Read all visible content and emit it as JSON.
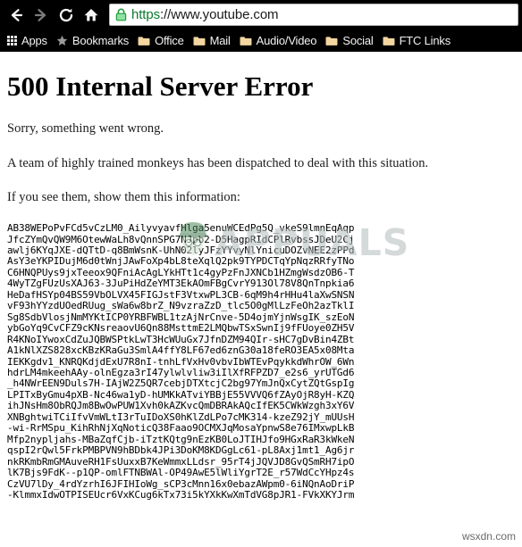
{
  "browser": {
    "nav": {
      "back_label": "Back",
      "forward_label": "Forward",
      "reload_label": "Reload",
      "home_label": "Home"
    },
    "omnibox": {
      "scheme": "https",
      "rest": "://www.youtube.com",
      "full_url": "https://www.youtube.com",
      "security_icon": "lock-icon",
      "security_state": "secure"
    },
    "bookmarks": [
      {
        "label": "Apps",
        "icon": "apps-grid-icon"
      },
      {
        "label": "Bookmarks",
        "icon": "star-icon"
      },
      {
        "label": "Office",
        "icon": "folder-icon"
      },
      {
        "label": "Mail",
        "icon": "folder-icon"
      },
      {
        "label": "Audio/Video",
        "icon": "folder-icon"
      },
      {
        "label": "Social",
        "icon": "folder-icon"
      },
      {
        "label": "FTC Links",
        "icon": "folder-icon"
      }
    ]
  },
  "page": {
    "title": "500 Internal Server Error",
    "paragraph_1": "Sorry, something went wrong.",
    "paragraph_2": "A team of highly trained monkeys has been dispatched to deal with this situation.",
    "paragraph_3": "If you see them, show them this information:",
    "error_code": "AB38WEPoPvFCd5vCzLM0_AilyvyavfHlga5enuWCEdPg5Q_vkeS9lmnEqAqp\nJfcZYmQvQW9M6OtewWaLh8vQnnSPG7NJpb2-D5HagpRIdCPlRvbssJDeU2Cj\nawlj6KYqJXE-dQTtD-q8BmWsnK-UhN02lyJFzYYvyNlYnicuDOZvNEE2zPPd\nAsY3eYKPIDujM6d0tWnjJAwFoXp4bL8teXqlQ2pk9TYPDCTqYpNqzRRfyTNo\nC6HNQPUys9jxTeeox9QFniAcAgLYkHTt1c4gyPzFnJXNCb1HZmgWsdzOB6-T\n4WyTZgFUzUsXAJ63-3JuPiHdZeYMT3EkAOmFBgCvrY913Ol78V8QnTnpkia6\nHeDafHSYp04BS59VbOLVX45FIGJstF3VtxwPL3CB-6qM9h4rHHu4laXwSNSN\nvF93hYYzdUOedRUug_sWa6w8brZ_N9vzraZzD_tlc5O0gMlLzFeOh2azTklI\nSg8SdbVlosjNmMYKtICP0YRBFWBL1tzAjNrCnve-5D4ojmYjnWsgIK_szEoN\nybGoYq9CvCFZ9cKNsreaovU6Qn88MsttmE2LMQbwTSxSwnIj9fFUoye0ZH5V\nR4KNoIYwoxCdZuJQBWSPtkLwT3HcWUuGx7JfnDZM94QIr-sHC7gDvBin4ZBt\nA1kNlXZS828xcKBzKRaGu3SmlA4ffY8LF67ed6znG30a18feRO3EA5x08Mta\nIEKKgdv1_KNRQKdjdExU7R8nI-tnhLfVxHv0vbvIbWTEvPqykkdWhrOW_6Wn\nhdrLM4mkeehAAy-olnEgza3rI47ylwlvliw3iIlXfRFPZD7_e2s6_yrUTGd6\n_h4NWrEEN9Duls7H-IAjW2Z5QR7cebjDTXtcjC2bg97YmJnQxCytZQtGspIg\nLPITxByGmu4pXB-Nc46wa1yD-hUMKkATviYBBjE55VVVQ6fZAyOjR8yH-KZQ\nihJNsHm8ObRQJm8BwOwPUW1Xvh0kAZKvcQmDBRAkAQcIfEK5CWkWzgh3xY6V\nXNBghtwiTCiIfvVmWLtI3rTuIDoXS0hKlZdLPo7cMK314-kzeZ92jY_mUUsH\n-wi-RrMSpu_KihRhNjXqNoticQ38Faao9OCMXJqMosaYpnwS8e76IMxwpLkB\nMfp2nypljahs-MBaZqfCjb-iTztKQtg9nEzKB0LoJTIHJfo9HGxRaR3kWkeN\nqspI2rQwl5FrkPMBPVN9hBDbk4JPi3DoKM8KDGgLc61-pL8Axj1mt1_Ag6jr\nnkRKmbRmGMAuveRH1FsUuxxB7KeWmmxLLdsr_95rT4jJQVJD8GvQSmRH7ipO\nlK7Bjs9FdK--p1QP-omlFTNBWAl-OP49AwE5lWliYgrT2E_r57WdCcYHpz4s\nCzVU7lDy_4rdYzrhI6JFIHIoWg_sCP3cMnn16x0ebazAWpm0-6iNQnAoDriP\n-KlmmxIdwOTPISEUcr6VxKCug6kTx73i5kYXkKwXmTdVG8pJR1-FVkXKYJrm"
  },
  "watermarks": {
    "appuals": "APPUALS",
    "wsxdn": "wsxdn.com"
  },
  "colors": {
    "chrome_background": "#000000",
    "secure_green": "#0a7a2f",
    "folder_tan": "#f3d6a0",
    "page_background": "#ffffff"
  }
}
